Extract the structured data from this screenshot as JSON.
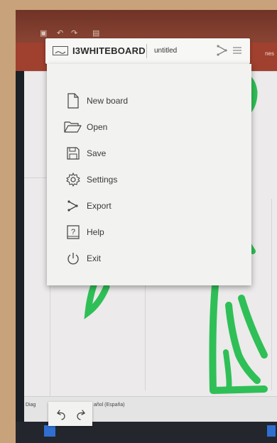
{
  "app_header": {
    "brand": "I3WHITEBOARD",
    "document_title": "untitled"
  },
  "menu": {
    "items": [
      {
        "label": "New board",
        "icon": "new-document-icon"
      },
      {
        "label": "Open",
        "icon": "folder-icon"
      },
      {
        "label": "Save",
        "icon": "floppy-disk-icon"
      },
      {
        "label": "Settings",
        "icon": "gear-icon"
      },
      {
        "label": "Export",
        "icon": "export-share-icon"
      },
      {
        "label": "Help",
        "icon": "help-icon"
      },
      {
        "label": "Exit",
        "icon": "power-icon"
      }
    ]
  },
  "undo_redo": {
    "icons": [
      "undo-icon",
      "redo-icon"
    ]
  },
  "background_app": {
    "status_left": "Diag",
    "status_language": "añol (España)",
    "ribbon_partial": "nes"
  },
  "colors": {
    "ink": "#2fbf57",
    "menu_bg": "#f2f2f0",
    "office_red": "#a0402e"
  }
}
